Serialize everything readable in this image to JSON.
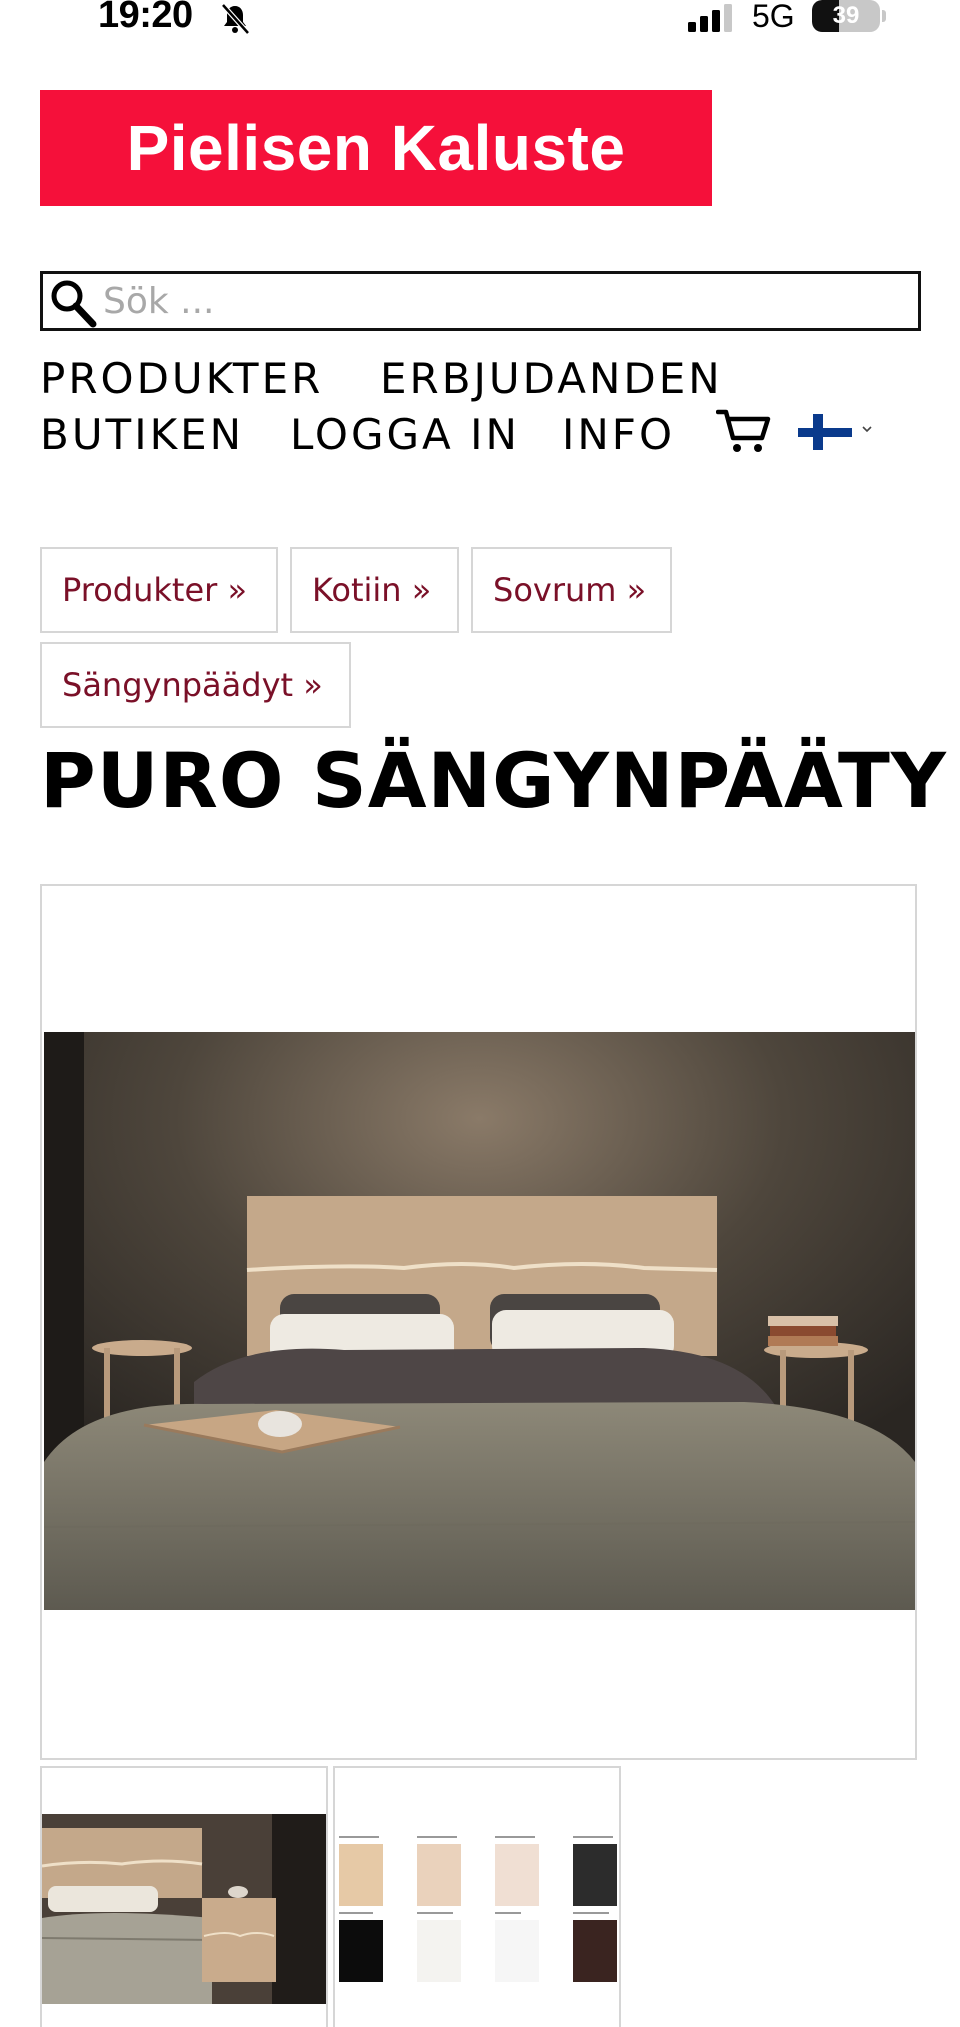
{
  "status_bar": {
    "time": "19:20",
    "network": "5G",
    "battery_level": "39",
    "battery_fraction": 0.39
  },
  "logo": {
    "text": "Pielisen Kaluste",
    "color": "#f5103a"
  },
  "search": {
    "placeholder": "Sök ...",
    "value": ""
  },
  "nav": {
    "items": [
      {
        "label": "PRODUKTER"
      },
      {
        "label": "ERBJUDANDEN"
      },
      {
        "label": "BUTIKEN"
      },
      {
        "label": "LOGGA IN"
      },
      {
        "label": "INFO"
      }
    ],
    "cart_icon": "cart-icon",
    "language_icon": "finland-flag-icon"
  },
  "breadcrumbs": [
    {
      "label": "Produkter »"
    },
    {
      "label": "Kotiin »"
    },
    {
      "label": "Sovrum »"
    },
    {
      "label": "Sängynpäädyt »"
    }
  ],
  "colors": {
    "breadcrumb_text": "#7a1028",
    "border": "#d6d6d6"
  },
  "product": {
    "title": "PURO SÄNGYNPÄÄTY"
  }
}
